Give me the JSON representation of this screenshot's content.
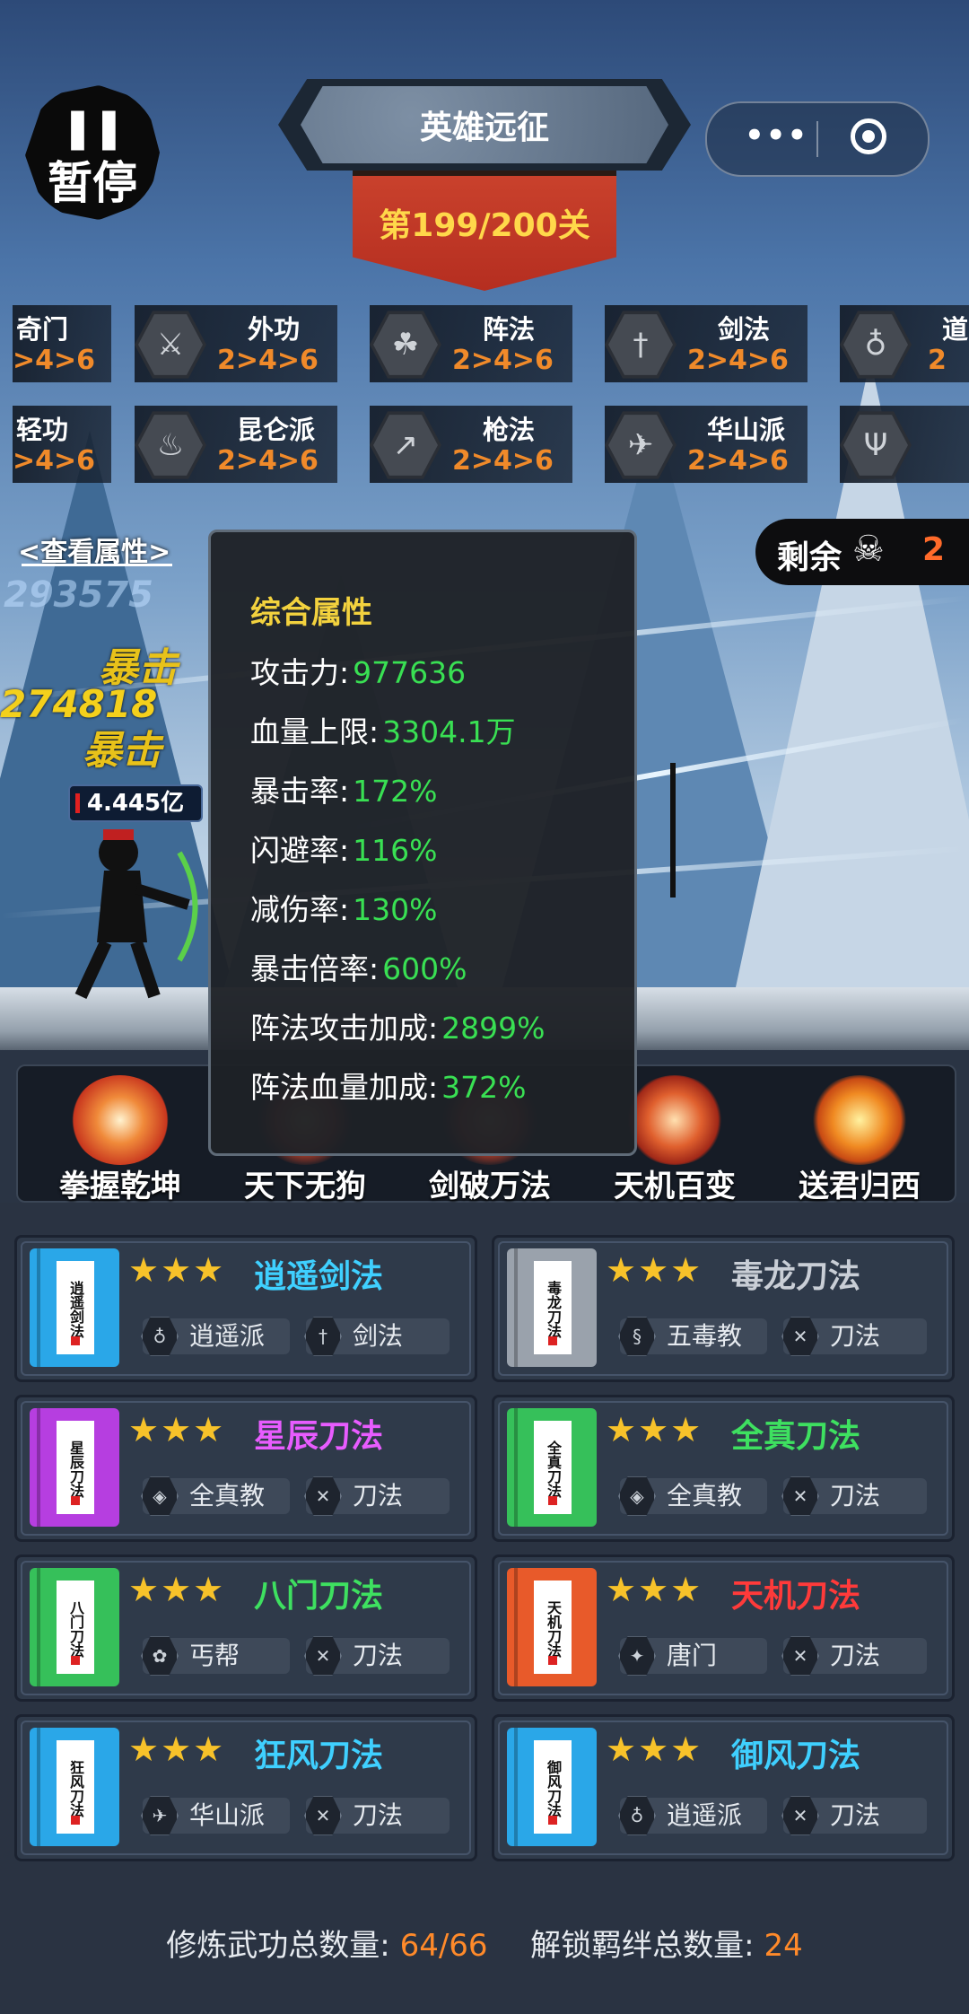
{
  "pause": {
    "label": "暂停"
  },
  "title": "英雄远征",
  "stage": "第199/200关",
  "bond_tags_row1": [
    {
      "name": "奇门",
      "level": ">4>6",
      "icon": "partial-icon"
    },
    {
      "name": "外功",
      "level": "2>4>6",
      "icon": "crossed-axes-icon"
    },
    {
      "name": "阵法",
      "level": "2>4>6",
      "icon": "triquetra-icon"
    },
    {
      "name": "剑法",
      "level": "2>4>6",
      "icon": "sword-icon"
    },
    {
      "name": "道",
      "level": "2",
      "icon": "gourd-icon"
    }
  ],
  "bond_tags_row2": [
    {
      "name": "轻功",
      "level": ">4>6",
      "icon": "partial-icon"
    },
    {
      "name": "昆仑派",
      "level": "2>4>6",
      "icon": "flame-icon"
    },
    {
      "name": "枪法",
      "level": "2>4>6",
      "icon": "spear-icon"
    },
    {
      "name": "华山派",
      "level": "2>4>6",
      "icon": "crane-icon"
    },
    {
      "name": "",
      "level": "",
      "icon": "trident-icon"
    }
  ],
  "view_attributes": "查看属性",
  "remaining": {
    "label": "剩余",
    "count": "2",
    "icon": "skull-icon"
  },
  "damage_numbers": [
    "293575",
    "暴击",
    "274818",
    "暴击"
  ],
  "hero_hp": "4.445亿",
  "stats_panel": {
    "heading": "综合属性",
    "rows": [
      {
        "label": "攻击力:",
        "value": "977636"
      },
      {
        "label": "血量上限:",
        "value": "3304.1万"
      },
      {
        "label": "暴击率:",
        "value": "172%"
      },
      {
        "label": "闪避率:",
        "value": "116%"
      },
      {
        "label": "减伤率:",
        "value": "130%"
      },
      {
        "label": "暴击倍率:",
        "value": "600%"
      },
      {
        "label": "阵法攻击加成:",
        "value": "2899%"
      },
      {
        "label": "阵法血量加成:",
        "value": "372%"
      }
    ]
  },
  "skills": [
    {
      "label": "拳握乾坤",
      "color": "#e8522a"
    },
    {
      "label": "天下无狗",
      "color": "#c8361e"
    },
    {
      "label": "剑破万法",
      "color": "#d2442a"
    },
    {
      "label": "天机百变",
      "color": "#e0602e"
    },
    {
      "label": "送君归西",
      "color": "#f08a22"
    }
  ],
  "cards": [
    {
      "book": "逍遥剑法",
      "name": "逍遥剑法",
      "name_color": "#3fd0ff",
      "book_color": "#2aa7e8",
      "stars": "★★★",
      "tags": [
        {
          "icon": "gourd-icon",
          "label": "逍遥派"
        },
        {
          "icon": "sword-icon",
          "label": "剑法"
        }
      ]
    },
    {
      "book": "毒龙刀法",
      "name": "毒龙刀法",
      "name_color": "#c9ced6",
      "book_color": "#9aa2ac",
      "stars": "★★★",
      "tags": [
        {
          "icon": "serpent-icon",
          "label": "五毒教"
        },
        {
          "icon": "blades-icon",
          "label": "刀法"
        }
      ]
    },
    {
      "book": "星辰刀法",
      "name": "星辰刀法",
      "name_color": "#e85cff",
      "book_color": "#b63ee0",
      "stars": "★★★",
      "tags": [
        {
          "icon": "shield-icon",
          "label": "全真教"
        },
        {
          "icon": "blades-icon",
          "label": "刀法"
        }
      ]
    },
    {
      "book": "全真刀法",
      "name": "全真刀法",
      "name_color": "#3ee060",
      "book_color": "#36c05a",
      "stars": "★★★",
      "tags": [
        {
          "icon": "shield-icon",
          "label": "全真教"
        },
        {
          "icon": "blades-icon",
          "label": "刀法"
        }
      ]
    },
    {
      "book": "八门刀法",
      "name": "八门刀法",
      "name_color": "#3ee060",
      "book_color": "#36c05a",
      "stars": "★★★",
      "tags": [
        {
          "icon": "lotus-icon",
          "label": "丐帮"
        },
        {
          "icon": "blades-icon",
          "label": "刀法"
        }
      ]
    },
    {
      "book": "天机刀法",
      "name": "天机刀法",
      "name_color": "#ff3a3a",
      "book_color": "#e85a2a",
      "stars": "★★★",
      "tags": [
        {
          "icon": "shuriken-icon",
          "label": "唐门"
        },
        {
          "icon": "blades-icon",
          "label": "刀法"
        }
      ]
    },
    {
      "book": "狂风刀法",
      "name": "狂风刀法",
      "name_color": "#3fd0ff",
      "book_color": "#2aa7e8",
      "stars": "★★★",
      "tags": [
        {
          "icon": "crane-icon",
          "label": "华山派"
        },
        {
          "icon": "blades-icon",
          "label": "刀法"
        }
      ]
    },
    {
      "book": "御风刀法",
      "name": "御风刀法",
      "name_color": "#3fd0ff",
      "book_color": "#2aa7e8",
      "stars": "★★★",
      "tags": [
        {
          "icon": "gourd-icon",
          "label": "逍遥派"
        },
        {
          "icon": "blades-icon",
          "label": "刀法"
        }
      ]
    }
  ],
  "footer": {
    "skills_label": "修炼武功总数量:",
    "skills_value": "64/66",
    "bonds_label": "解锁羁绊总数量:",
    "bonds_value": "24"
  }
}
